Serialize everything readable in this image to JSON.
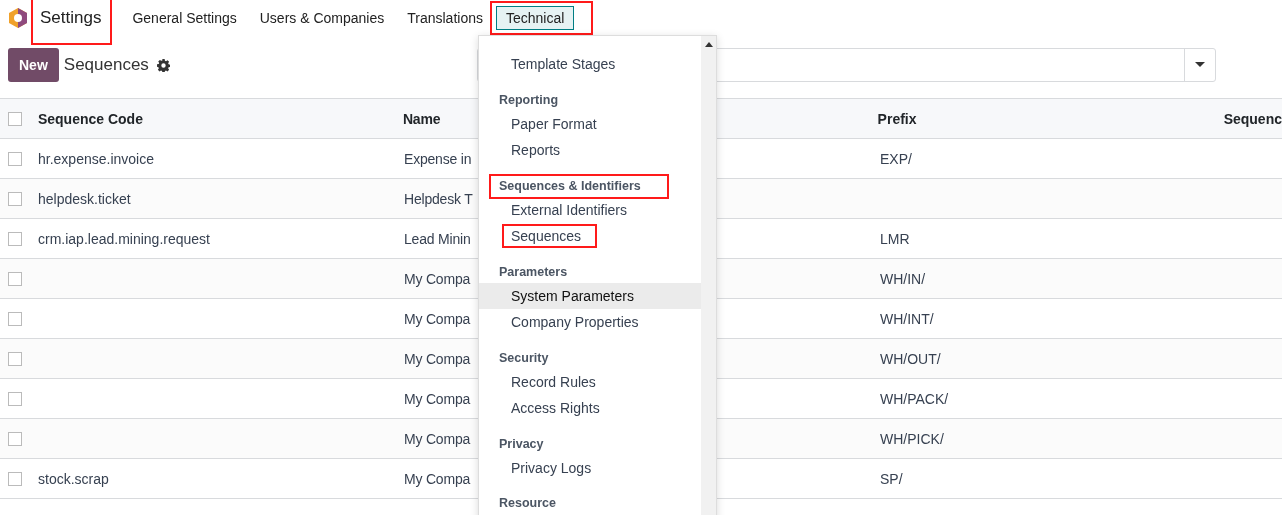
{
  "navbar": {
    "app_title": {
      "label": "Settings",
      "annotated": true
    },
    "menu": [
      {
        "label": "General Settings",
        "open": false,
        "annotated": false
      },
      {
        "label": "Users & Companies",
        "open": false,
        "annotated": false
      },
      {
        "label": "Translations",
        "open": false,
        "annotated": false
      },
      {
        "label": "Technical",
        "open": true,
        "annotated": true
      }
    ]
  },
  "control_panel": {
    "new_button": "New",
    "title": "Sequences"
  },
  "table": {
    "all_checked": false,
    "columns": [
      {
        "label": "Sequence Code"
      },
      {
        "label": "Name"
      },
      {
        "label": "Prefix"
      },
      {
        "label": "Sequenc"
      }
    ],
    "rows": [
      {
        "code": "hr.expense.invoice",
        "name": "Expense in",
        "prefix": "EXP/",
        "checked": false
      },
      {
        "code": "helpdesk.ticket",
        "name": "Helpdesk T",
        "checked": false
      },
      {
        "code": "crm.iap.lead.mining.request",
        "name": "Lead Minin",
        "prefix": "LMR",
        "checked": false
      },
      {
        "name": "My Compa",
        "prefix": "WH/IN/",
        "checked": false
      },
      {
        "name": "My Compa",
        "prefix": "WH/INT/",
        "checked": false
      },
      {
        "name": "My Compa",
        "prefix": "WH/OUT/",
        "checked": false
      },
      {
        "name": "My Compa",
        "prefix": "WH/PACK/",
        "checked": false
      },
      {
        "name": "My Compa",
        "prefix": "WH/PICK/",
        "checked": false
      },
      {
        "code": "stock.scrap",
        "name": "My Compa",
        "prefix": "SP/",
        "checked": false
      }
    ]
  },
  "dropdown": {
    "sections": [
      {
        "items": [
          {
            "label": "Template Stages",
            "highlighted": false,
            "annotated": false
          }
        ]
      },
      {
        "header": "Reporting",
        "annotated": false,
        "items": [
          {
            "label": "Paper Format",
            "highlighted": false,
            "annotated": false
          },
          {
            "label": "Reports",
            "highlighted": false,
            "annotated": false
          }
        ]
      },
      {
        "header": "Sequences & Identifiers",
        "annotated": true,
        "items": [
          {
            "label": "External Identifiers",
            "highlighted": false,
            "annotated": false
          },
          {
            "label": "Sequences",
            "highlighted": false,
            "annotated": true
          }
        ]
      },
      {
        "header": "Parameters",
        "annotated": false,
        "items": [
          {
            "label": "System Parameters",
            "highlighted": true,
            "annotated": false
          },
          {
            "label": "Company Properties",
            "highlighted": false,
            "annotated": false
          }
        ]
      },
      {
        "header": "Security",
        "annotated": false,
        "items": [
          {
            "label": "Record Rules",
            "highlighted": false,
            "annotated": false
          },
          {
            "label": "Access Rights",
            "highlighted": false,
            "annotated": false
          }
        ]
      },
      {
        "header": "Privacy",
        "annotated": false,
        "items": [
          {
            "label": "Privacy Logs",
            "highlighted": false,
            "annotated": false
          }
        ]
      },
      {
        "header": "Resource",
        "annotated": false
      }
    ]
  }
}
